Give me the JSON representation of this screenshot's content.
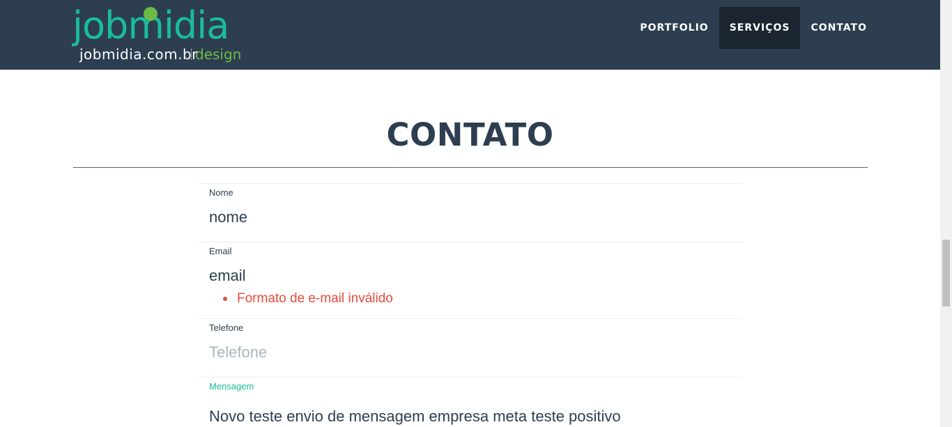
{
  "brand": {
    "wordmark": "jobmidia",
    "domain": "jobmidia.com.br",
    "tagline": "design",
    "colors": {
      "primary": "#1abc9c",
      "dot": "#6dbb45",
      "navbar": "#2c3e50"
    }
  },
  "nav": {
    "items": [
      {
        "label": "PORTFOLIO",
        "active": false
      },
      {
        "label": "SERVIÇOS",
        "active": true
      },
      {
        "label": "CONTATO",
        "active": false
      }
    ]
  },
  "contact": {
    "title": "CONTATO",
    "fields": {
      "nome": {
        "label": "Nome",
        "value": "nome",
        "placeholder": "Nome"
      },
      "email": {
        "label": "Email",
        "value": "email",
        "placeholder": "Email",
        "error": "Formato de e-mail inválido"
      },
      "telefone": {
        "label": "Telefone",
        "value": "",
        "placeholder": "Telefone"
      },
      "mensagem": {
        "label": "Mensagem",
        "value": "Novo teste envio de mensagem empresa meta teste positivo",
        "placeholder": "Mensagem"
      }
    }
  },
  "colors": {
    "error": "#e74c3c",
    "focus": "#18bc9c",
    "text": "#2c3e50"
  }
}
